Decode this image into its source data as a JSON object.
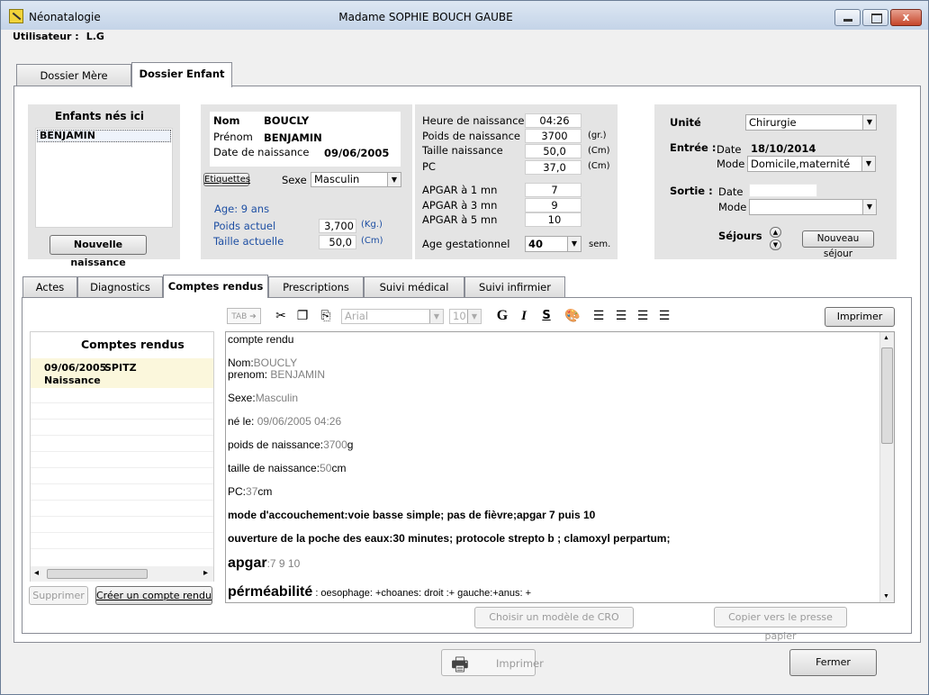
{
  "window": {
    "app_name": "Néonatalogie",
    "title": "Madame SOPHIE BOUCH GAUBE",
    "close_glyph": "x"
  },
  "user": {
    "label": "Utilisateur :",
    "value": "L.G"
  },
  "main_tabs": [
    {
      "label": "Dossier Mère"
    },
    {
      "label": "Dossier Enfant"
    }
  ],
  "born_panel": {
    "title": "Enfants nés ici",
    "items": [
      "BENJAMIN"
    ],
    "new_button": "Nouvelle naissance"
  },
  "child": {
    "nom_label": "Nom",
    "nom": "BOUCLY",
    "prenom_label": "Prénom",
    "prenom": "BENJAMIN",
    "dob_label": "Date de naissance",
    "dob": "09/06/2005",
    "etiquettes_button": "Etiquettes",
    "sexe_label": "Sexe",
    "sexe": "Masculin",
    "age": "Age: 9 ans",
    "poids_label": "Poids actuel",
    "poids": "3,700",
    "poids_unit": "(Kg.)",
    "taille_label": "Taille actuelle",
    "taille": "50,0",
    "taille_unit": "(Cm)"
  },
  "birth": {
    "heure_label": "Heure de naissance",
    "heure": "04:26",
    "poids_label": "Poids de naissance",
    "poids": "3700",
    "poids_unit": "(gr.)",
    "taille_label": "Taille naissance",
    "taille": "50,0",
    "taille_unit": "(Cm)",
    "pc_label": "PC",
    "pc": "37,0",
    "pc_unit": "(Cm)",
    "apgar1_label": "APGAR à 1 mn",
    "apgar1": "7",
    "apgar3_label": "APGAR à 3 mn",
    "apgar3": "9",
    "apgar5_label": "APGAR à 5 mn",
    "apgar5": "10",
    "age_gest_label": "Age gestationnel",
    "age_gest": "40",
    "age_gest_unit": "sem."
  },
  "stay": {
    "unite_label": "Unité",
    "unite": "Chirurgie",
    "entree_label": "Entrée :",
    "entree_date_label": "Date",
    "entree_date": "18/10/2014",
    "entree_mode_label": "Mode",
    "entree_mode": "Domicile,maternité",
    "sortie_label": "Sortie :",
    "sortie_date_label": "Date",
    "sortie_date": "",
    "sortie_mode_label": "Mode",
    "sortie_mode": "",
    "sejours_label": "Séjours",
    "new_stay_button": "Nouveau séjour"
  },
  "sub_tabs": [
    {
      "label": "Actes"
    },
    {
      "label": "Diagnostics"
    },
    {
      "label": "Comptes rendus"
    },
    {
      "label": "Prescriptions"
    },
    {
      "label": "Suivi médical"
    },
    {
      "label": "Suivi infirmier"
    }
  ],
  "reports": {
    "title": "Comptes rendus",
    "items": [
      {
        "date": "09/06/2005",
        "author": "SPITZ",
        "type": "Naissance"
      }
    ],
    "delete_button": "Supprimer",
    "create_button": "Créer un compte rendu"
  },
  "toolbar": {
    "tab_label": "TAB",
    "font": "Arial",
    "size": "10",
    "bold": "G",
    "italic": "I",
    "strike": "S",
    "print_button": "Imprimer"
  },
  "editor": {
    "l1": "compte rendu",
    "nom_l": "Nom:",
    "nom_v": "BOUCLY",
    "prenom_l": "prenom:",
    "prenom_v": " BENJAMIN",
    "sexe_l": "Sexe:",
    "sexe_v": "Masculin",
    "ne_l": "né le: ",
    "ne_v": "09/06/2005   04:26",
    "poids_l": "poids de naissance:",
    "poids_v": "3700",
    "poids_u": "g",
    "taille_l": "taille de naissance:",
    "taille_v": "50",
    "taille_u": "cm",
    "pc_l": "PC:",
    "pc_v": "37",
    "pc_u": "cm",
    "mode": "mode d'accouchement:voie basse simple; pas de fièvre;apgar 7 puis 10",
    "poche": "ouverture de la poche des eaux:30 minutes; protocole strepto b ; clamoxyl perpartum;",
    "apgar_l": "apgar",
    "apgar_v": ":7 9 10",
    "perm_l": "pérméabilité",
    "perm_v": " : oesophage: +choanes: droit :+  gauche:+anus: +"
  },
  "bottom": {
    "choose_model": "Choisir un modèle de CRO",
    "copy_clipboard": "Copier vers le presse papier",
    "print": "Imprimer",
    "close": "Fermer"
  }
}
